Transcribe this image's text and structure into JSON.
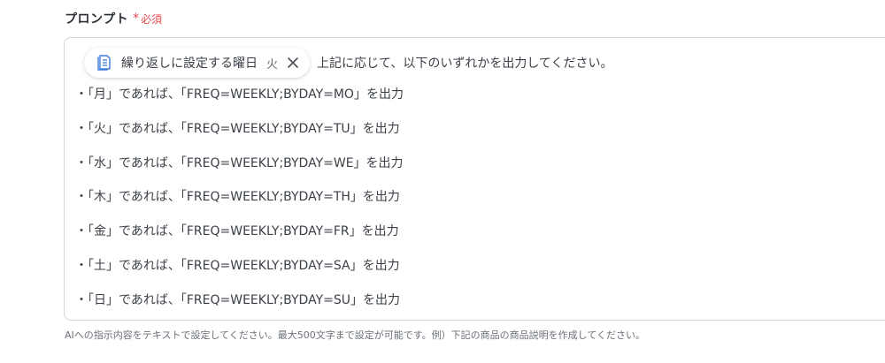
{
  "field": {
    "label": "プロンプト",
    "required_star": "*",
    "required_text": "必須"
  },
  "prompt": {
    "chip": {
      "icon": "document-list-icon",
      "label": "繰り返しに設定する曜日",
      "value": "火"
    },
    "after_chip_text": "上記に応じて、以下のいずれかを出力してください。",
    "lines": [
      "・「月」であれば、「FREQ=WEEKLY;BYDAY=MO」を出力",
      "・「火」であれば、「FREQ=WEEKLY;BYDAY=TU」を出力",
      "・「水」であれば、「FREQ=WEEKLY;BYDAY=WE」を出力",
      "・「木」であれば、「FREQ=WEEKLY;BYDAY=TH」を出力",
      "・「金」であれば、「FREQ=WEEKLY;BYDAY=FR」を出力",
      "・「土」であれば、「FREQ=WEEKLY;BYDAY=SA」を出力",
      "・「日」であれば、「FREQ=WEEKLY;BYDAY=SU」を出力"
    ]
  },
  "help_text": "AIへの指示内容をテキストで設定してください。最大500文字まで設定が可能です。例）下記の商品の商品説明を作成してください。",
  "colors": {
    "required": "#e5484d",
    "border": "#d4d7dc",
    "text": "#3a3f47",
    "icon": "#3d7bd9"
  }
}
